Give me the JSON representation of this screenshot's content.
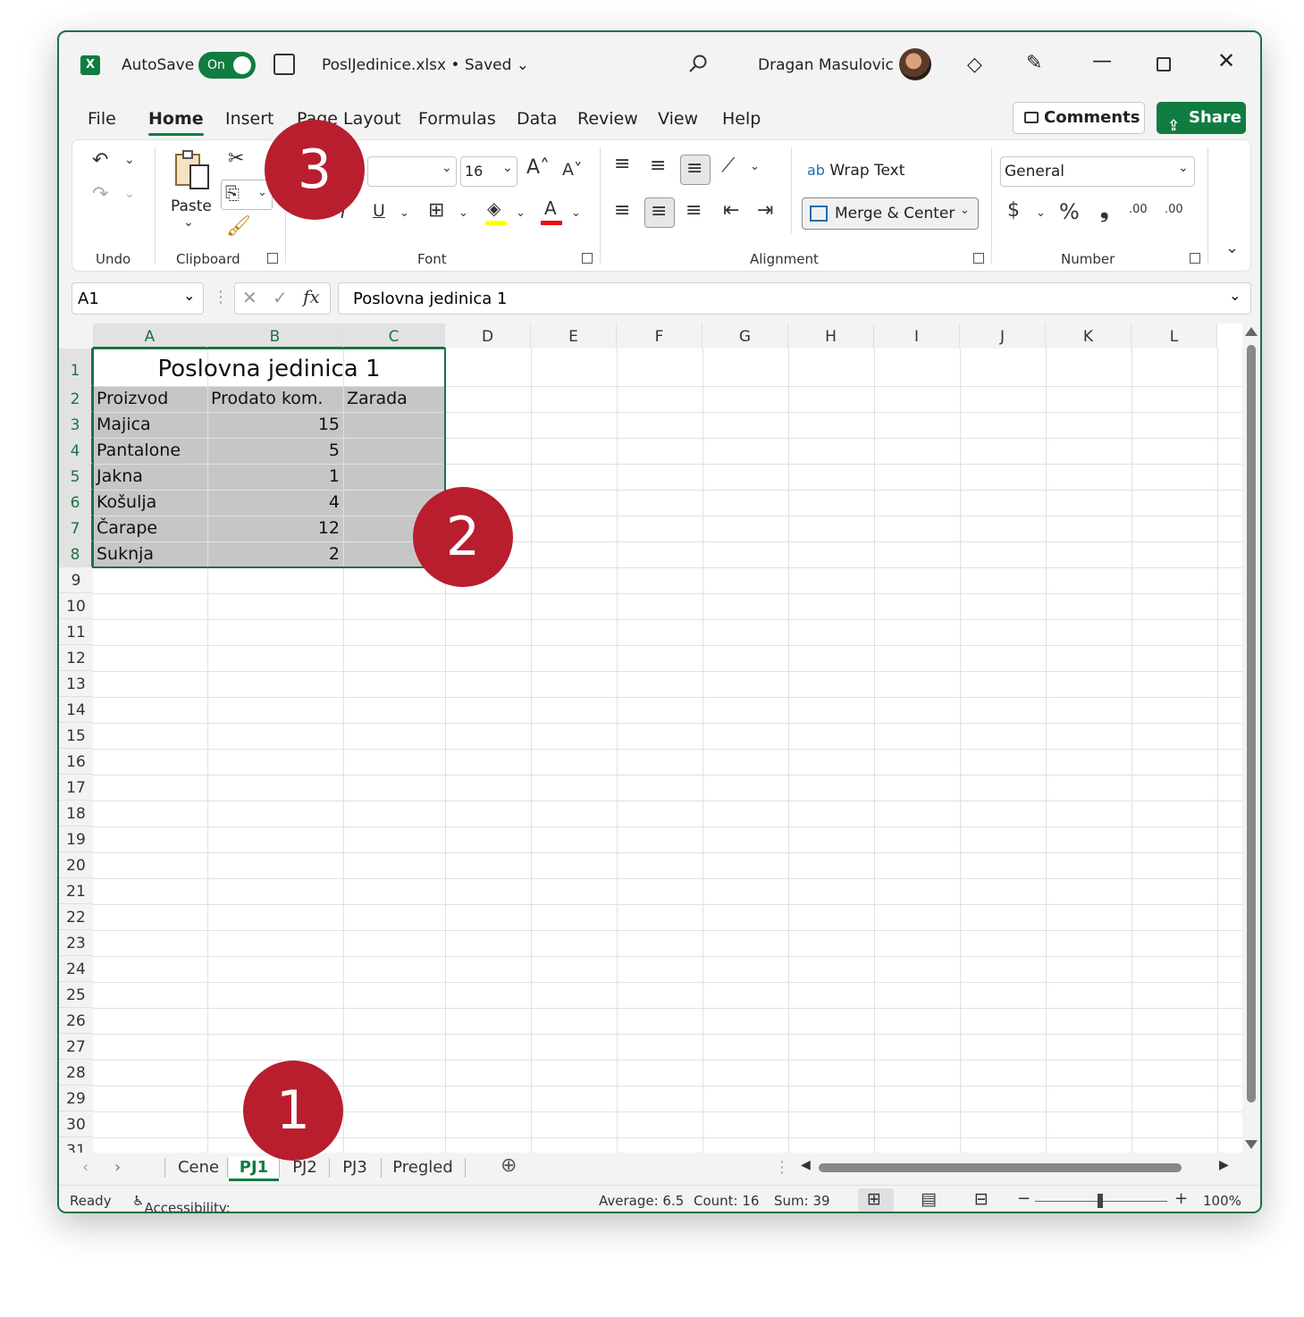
{
  "titlebar": {
    "app_logo": "X",
    "autosave_label": "AutoSave",
    "autosave_state": "On",
    "filename": "PoslJedinice.xlsx • Saved",
    "user_name": "Dragan Masulovic"
  },
  "menu": {
    "items": [
      "File",
      "Home",
      "Insert",
      "Page Layout",
      "Formulas",
      "Data",
      "Review",
      "View",
      "Help"
    ],
    "active": "Home",
    "comments_label": "Comments",
    "share_label": "Share"
  },
  "ribbon": {
    "groups": {
      "undo": "Undo",
      "clipboard": "Clipboard",
      "font": "Font",
      "alignment": "Alignment",
      "number": "Number"
    },
    "paste_label": "Paste",
    "font_size": "16",
    "wrap_text_label": "Wrap Text",
    "merge_center_label": "Merge & Center",
    "number_format": "General",
    "underline": "U",
    "italic": "I",
    "dollar": "$",
    "percent": "%",
    "comma": "❟",
    "inc_decimal": ".00",
    "dec_decimal": ".00"
  },
  "formula_bar": {
    "name_box": "A1",
    "formula": "Poslovna jedinica 1"
  },
  "sheet": {
    "columns": [
      "A",
      "B",
      "C",
      "D",
      "E",
      "F",
      "G",
      "H",
      "I",
      "J",
      "K",
      "L"
    ],
    "rows": [
      "1",
      "2",
      "3",
      "4",
      "5",
      "6",
      "7",
      "8",
      "9",
      "10",
      "11",
      "12",
      "13",
      "14",
      "15",
      "16",
      "17",
      "18",
      "19",
      "20",
      "21",
      "22",
      "23",
      "24",
      "25",
      "26",
      "27",
      "28",
      "29",
      "30",
      "31"
    ],
    "title": "Poslovna jedinica 1",
    "headers": [
      "Proizvod",
      "Prodato kom.",
      "Zarada"
    ],
    "data": [
      {
        "product": "Majica",
        "sold": "15"
      },
      {
        "product": "Pantalone",
        "sold": "5"
      },
      {
        "product": "Jakna",
        "sold": "1"
      },
      {
        "product": "Košulja",
        "sold": "4"
      },
      {
        "product": "Čarape",
        "sold": "12"
      },
      {
        "product": "Suknja",
        "sold": "2"
      }
    ]
  },
  "sheet_tabs": {
    "tabs": [
      "Cene",
      "PJ1",
      "PJ2",
      "PJ3",
      "Pregled"
    ],
    "active": "PJ1"
  },
  "status_bar": {
    "ready": "Ready",
    "accessibility": "Accessibility: Good to go",
    "average": "Average: 6.5",
    "count": "Count: 16",
    "sum": "Sum: 39",
    "zoom": "100%"
  },
  "callouts": [
    "1",
    "2",
    "3"
  ],
  "colors": {
    "accent": "#107c41",
    "callout": "#b81e2e",
    "selection_fill": "#c6c6c6"
  }
}
